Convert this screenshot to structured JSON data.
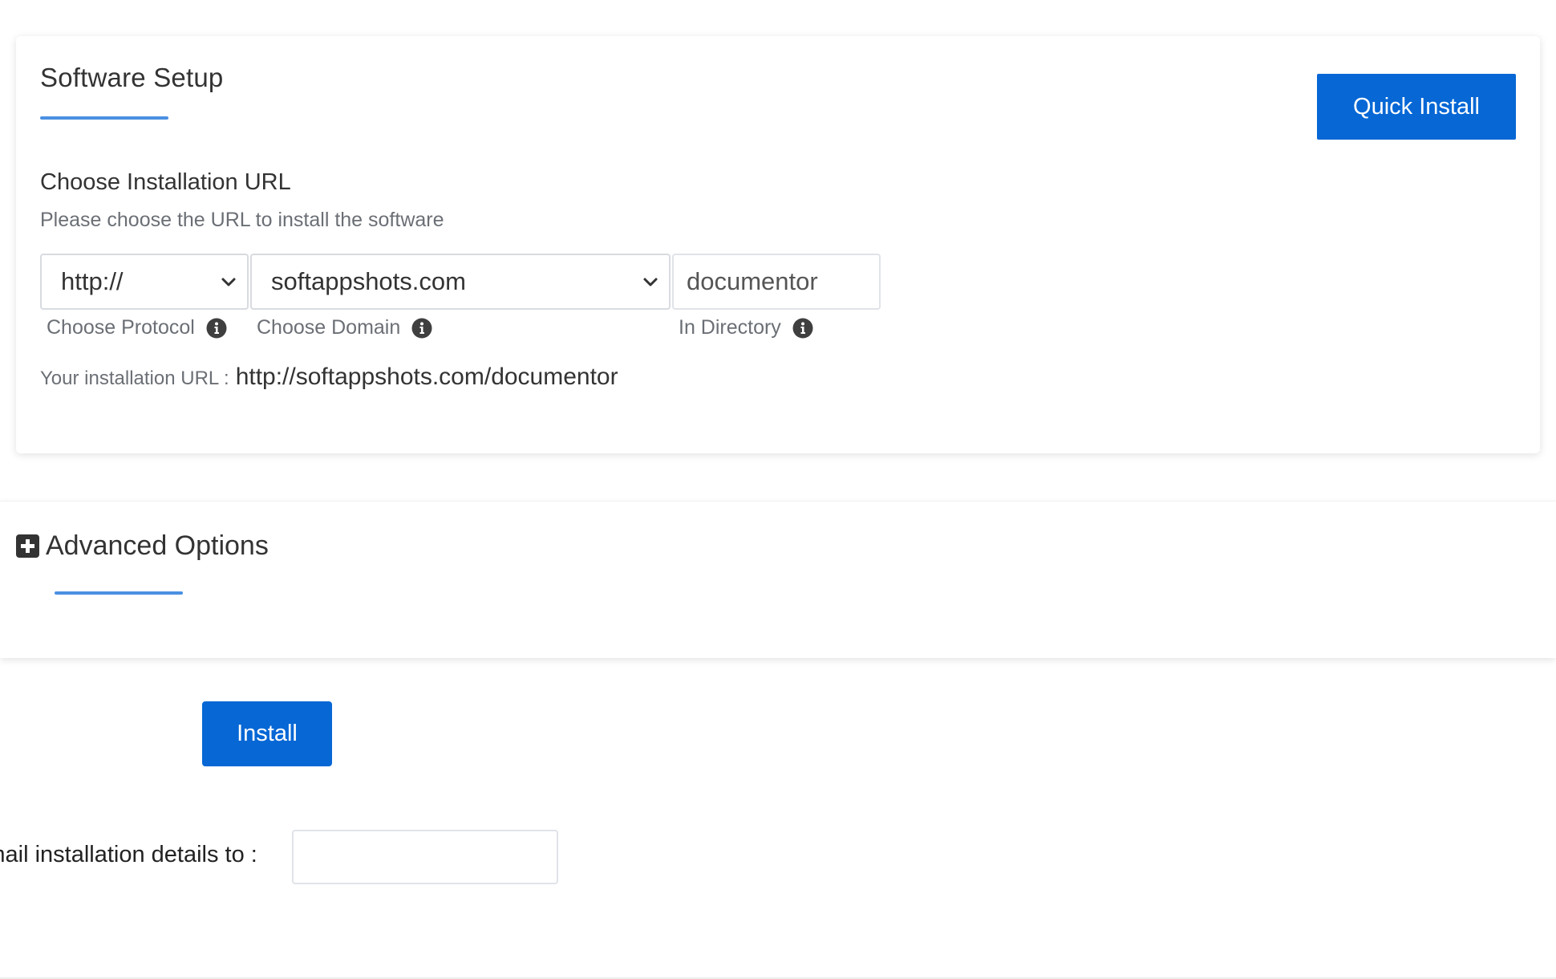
{
  "software_setup": {
    "title": "Software Setup",
    "quick_install_label": "Quick Install",
    "url_section": {
      "heading": "Choose Installation URL",
      "subheading": "Please choose the URL to install the software",
      "protocol_value": "http://",
      "domain_value": "softappshots.com",
      "directory_value": "documentor",
      "protocol_label": "Choose Protocol",
      "domain_label": "Choose Domain",
      "directory_label": "In Directory",
      "install_url_label": "Your installation URL :",
      "install_url_value": "http://softappshots.com/documentor"
    }
  },
  "advanced_options": {
    "title": "Advanced Options",
    "icon": "plus-square-icon"
  },
  "install": {
    "install_label": "Install",
    "email_label": "Email installation details to :",
    "email_value": ""
  },
  "colors": {
    "primary": "#0667d5",
    "accent_underline": "#4a90e2",
    "text": "#333333",
    "muted_text": "#6b6f75",
    "info_icon": "#3f3f3f"
  }
}
